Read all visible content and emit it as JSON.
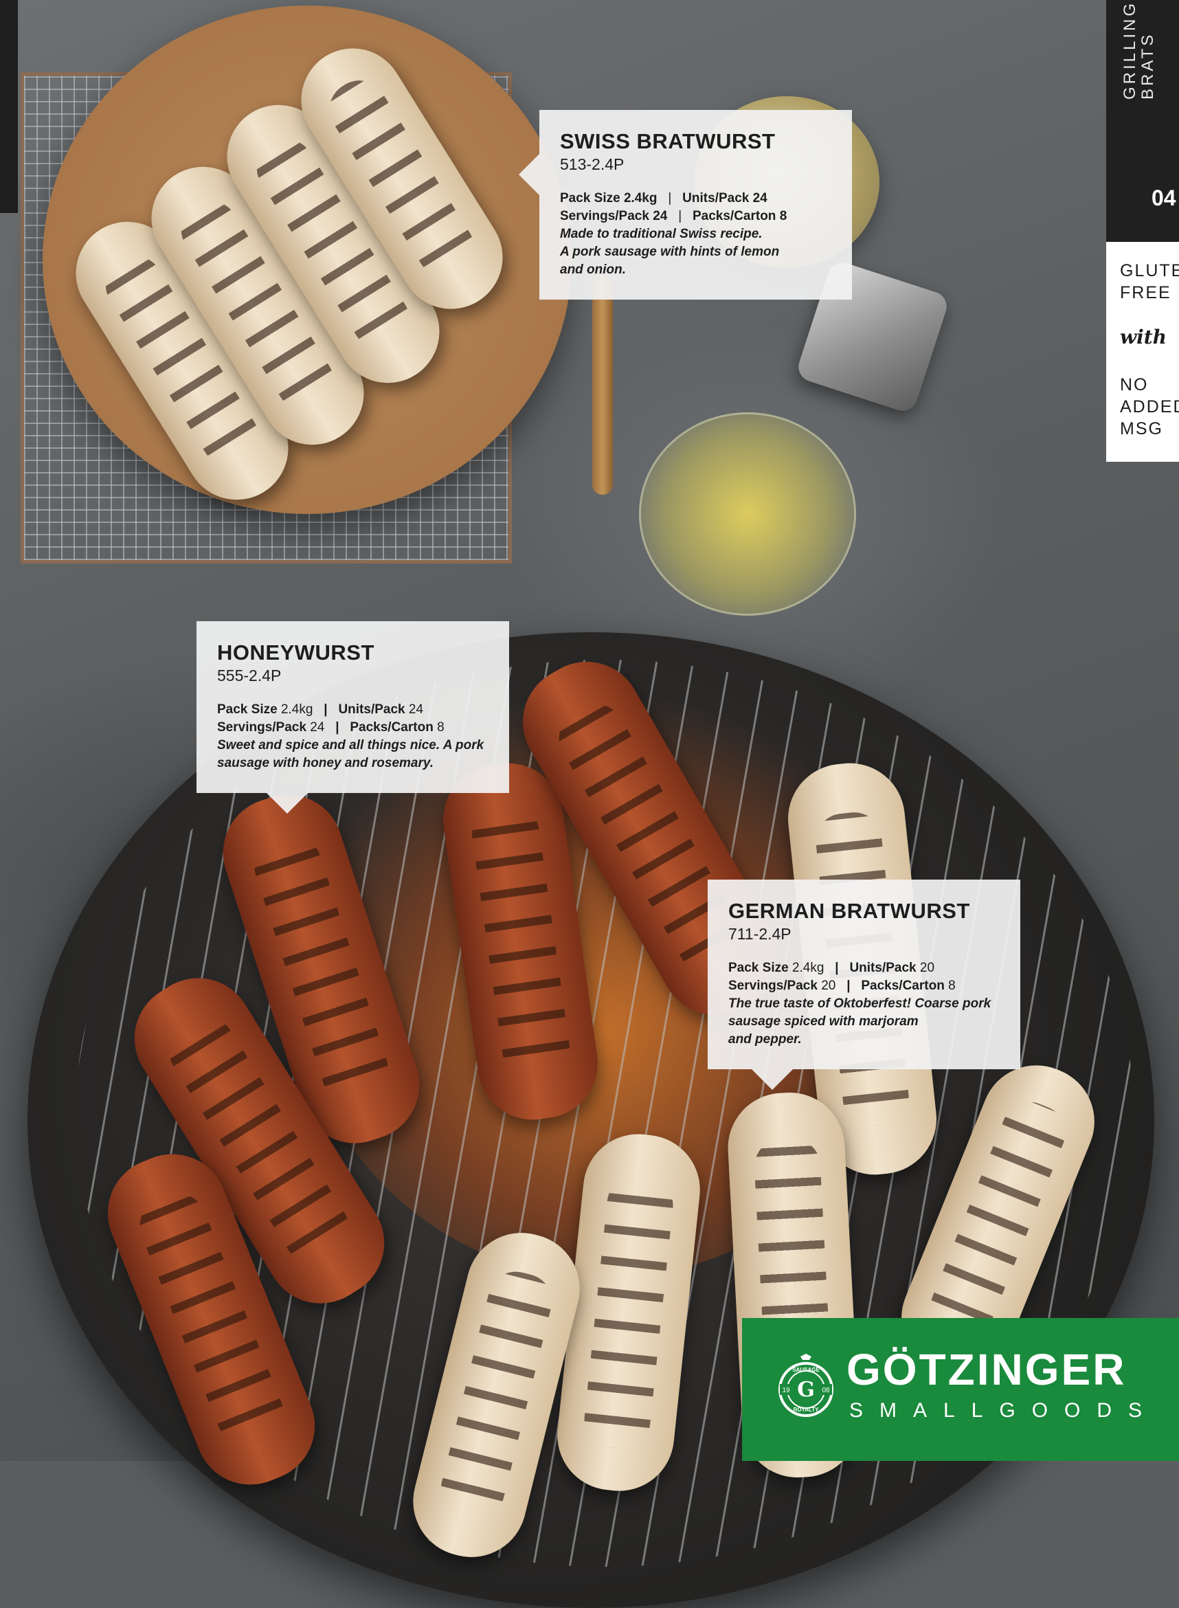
{
  "side_tab": {
    "line1": "GRILLING",
    "line2": "BRATS",
    "page_number": "04",
    "badge_gluten": "GLUTEN",
    "badge_free": "FREE",
    "badge_with": "with",
    "badge_no": "NO",
    "badge_added": "ADDED",
    "badge_msg": "MSG"
  },
  "products": [
    {
      "name": "SWISS BRATWURST",
      "code": "513-2.4P",
      "pack_size_label": "Pack Size",
      "pack_size": "2.4kg",
      "units_label": "Units/Pack",
      "units": "24",
      "servings_label": "Servings/Pack",
      "servings": "24",
      "packs_label": "Packs/Carton",
      "packs": "8",
      "desc_lines": [
        "Made to traditional Swiss recipe.",
        "A pork sausage with hints of lemon",
        "and onion."
      ]
    },
    {
      "name": "HONEYWURST",
      "code": "555-2.4P",
      "pack_size_label": "Pack Size",
      "pack_size": "2.4kg",
      "units_label": "Units/Pack",
      "units": "24",
      "servings_label": "Servings/Pack",
      "servings": "24",
      "packs_label": "Packs/Carton",
      "packs": "8",
      "desc_lines": [
        "Sweet and spice and all things nice. A pork",
        "sausage with honey and rosemary."
      ]
    },
    {
      "name": "GERMAN BRATWURST",
      "code": "711-2.4P",
      "pack_size_label": "Pack Size",
      "pack_size": "2.4kg",
      "units_label": "Units/Pack",
      "units": "20",
      "servings_label": "Servings/Pack",
      "servings": "20",
      "packs_label": "Packs/Carton",
      "packs": "8",
      "desc_lines": [
        "The true taste of Oktoberfest! Coarse pork",
        "sausage spiced with marjoram",
        "and pepper."
      ]
    }
  ],
  "separator": "|",
  "brand": {
    "name": "GÖTZINGER",
    "subtitle": "SMALLGOODS",
    "seal_top": "SAUSAGE",
    "seal_bottom": "ROYALTY",
    "seal_letter": "G",
    "seal_year_left": "19",
    "seal_year_right": "08",
    "color": "#1a8a3c"
  }
}
